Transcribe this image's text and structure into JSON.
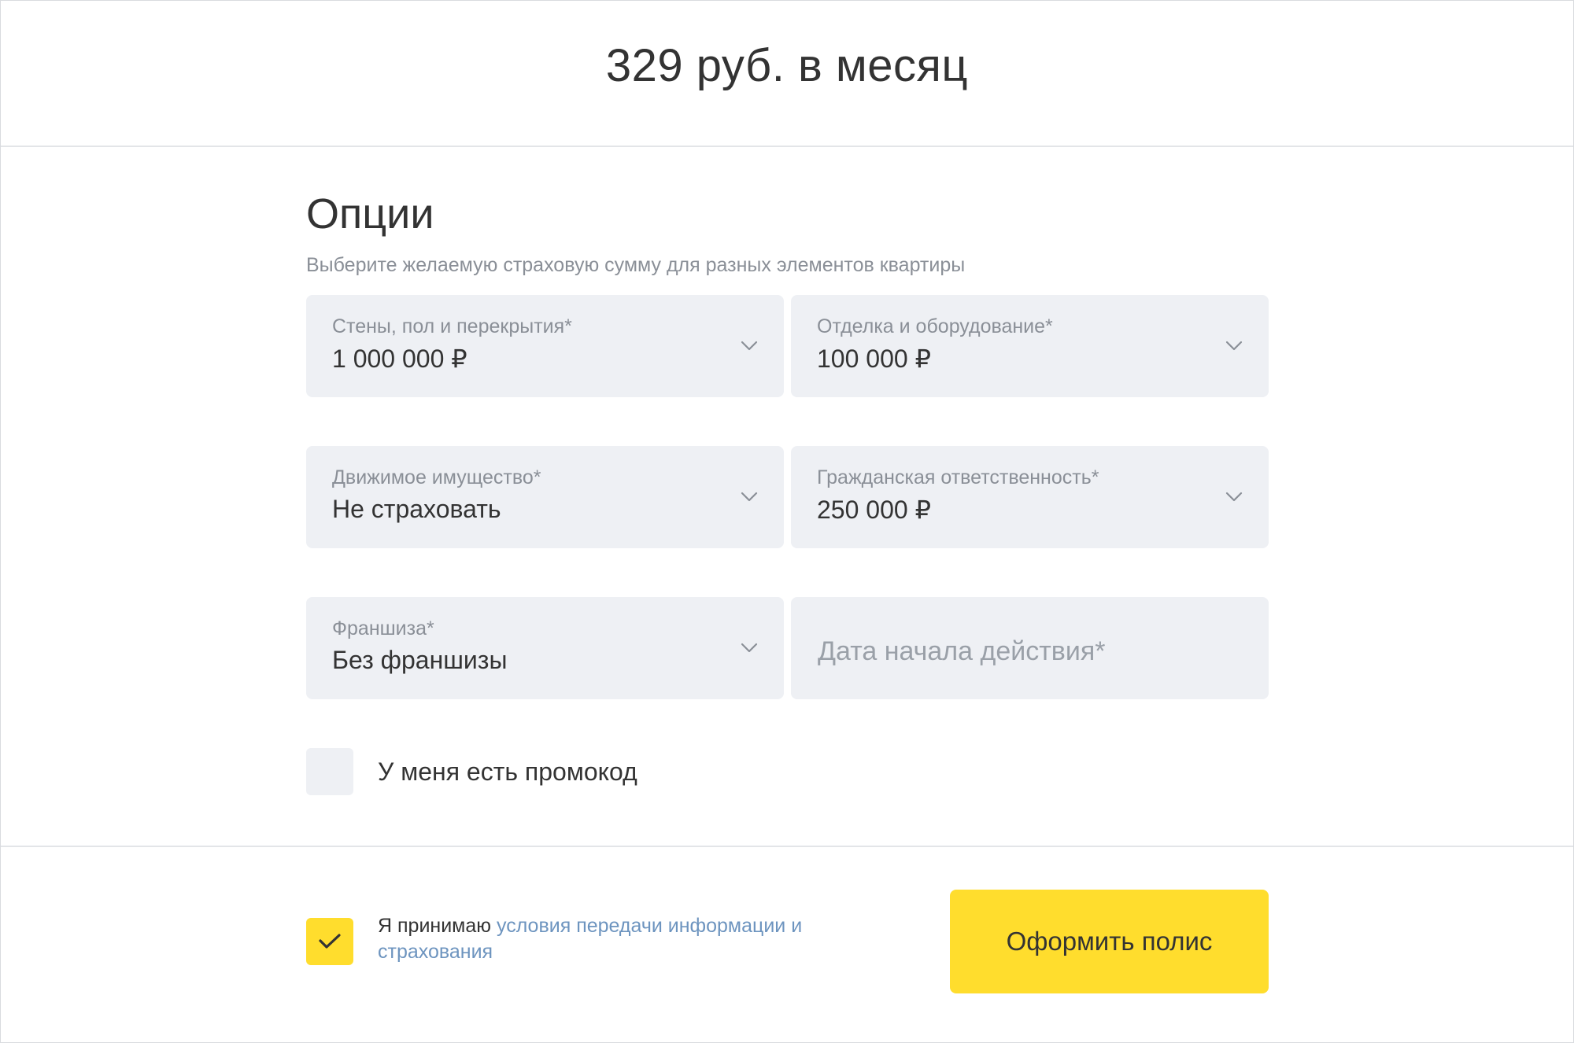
{
  "header": {
    "price": "329 руб. в месяц"
  },
  "options": {
    "title": "Опции",
    "subtitle": "Выберите желаемую страховую сумму для разных элементов квартиры",
    "fields": [
      {
        "label": "Стены, пол и перекрытия*",
        "value": "1 000 000 ₽"
      },
      {
        "label": "Отделка и оборудование*",
        "value": "100 000 ₽"
      },
      {
        "label": "Движимое имущество*",
        "value": "Не страховать"
      },
      {
        "label": "Гражданская ответственность*",
        "value": "250 000 ₽"
      },
      {
        "label": "Франшиза*",
        "value": "Без франшизы"
      }
    ],
    "date_placeholder": "Дата начала действия*",
    "promo_label": "У меня есть промокод",
    "promo_checked": false
  },
  "footer": {
    "agree_prefix": "Я принимаю ",
    "agree_link": "условия передачи информации и страхования",
    "agree_checked": true,
    "submit_label": "Оформить полис"
  },
  "colors": {
    "accent": "#ffdd2d",
    "field_bg": "#eef0f4",
    "link": "#6d94bf",
    "muted_text": "#8a8f97",
    "text": "#333333"
  },
  "icons": {
    "field_dropdown": "chevron-down-icon",
    "agree_check": "checkmark-icon"
  }
}
